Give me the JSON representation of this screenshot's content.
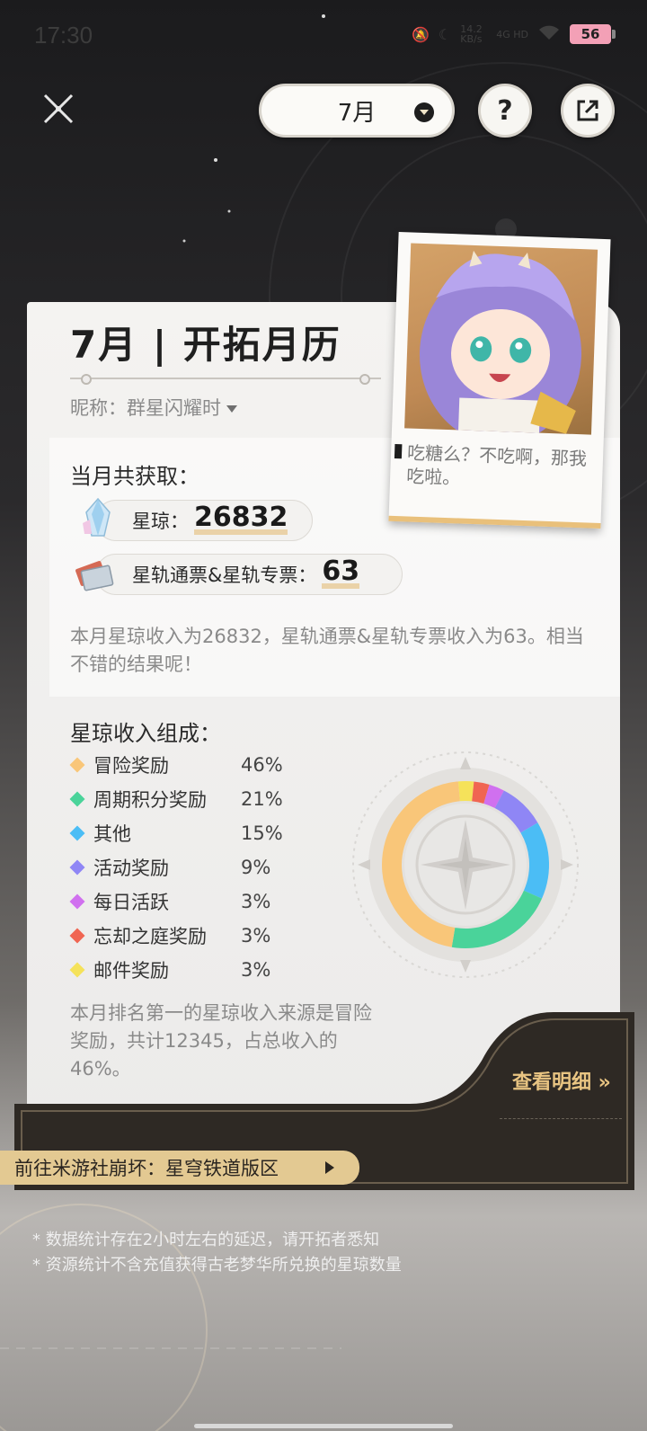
{
  "status_bar": {
    "time": "17:30",
    "network_speed": "14.2 KB/s",
    "network_type": "4G HD",
    "battery": "56"
  },
  "top_bar": {
    "month_selected": "7月",
    "help_label": "?"
  },
  "card": {
    "title": "7月 | 开拓月历",
    "nickname": "昵称：群星闪耀时"
  },
  "summary": {
    "heading": "当月共获取：",
    "stellar_jade_label": "星琼：",
    "stellar_jade_value": "26832",
    "passes_label": "星轨通票&星轨专票：",
    "passes_value": "63",
    "text": "本月星琼收入为26832，星轨通票&星轨专票收入为63。相当不错的结果呢！"
  },
  "character": {
    "quote": "吃糖么？不吃啊，那我吃啦。"
  },
  "composition": {
    "heading": "星琼收入组成：",
    "items": [
      {
        "name": "冒险奖励",
        "percent": "46%",
        "color": "#f9c679"
      },
      {
        "name": "周期积分奖励",
        "percent": "21%",
        "color": "#4ad39a"
      },
      {
        "name": "其他",
        "percent": "15%",
        "color": "#4bbdf5"
      },
      {
        "name": "活动奖励",
        "percent": "9%",
        "color": "#8f86f5"
      },
      {
        "name": "每日活跃",
        "percent": "3%",
        "color": "#d070ef"
      },
      {
        "name": "忘却之庭奖励",
        "percent": "3%",
        "color": "#f06552"
      },
      {
        "name": "邮件奖励",
        "percent": "3%",
        "color": "#f5e25a"
      }
    ],
    "text": "本月排名第一的星琼收入来源是冒险奖励，共计12345，占总收入的46%。"
  },
  "chart_data": {
    "type": "pie",
    "categories": [
      "冒险奖励",
      "周期积分奖励",
      "其他",
      "活动奖励",
      "每日活跃",
      "忘却之庭奖励",
      "邮件奖励"
    ],
    "values": [
      46,
      21,
      15,
      9,
      3,
      3,
      3
    ],
    "title": "",
    "legend": "left"
  },
  "actions": {
    "detail_link": "查看明细 »",
    "forum_button": "前往米游社崩坏：星穹铁道版区"
  },
  "notes": [
    "* 数据统计存在2小时左右的延迟，请开拓者悉知",
    "* 资源统计不含充值获得古老梦华所兑换的星琼数量"
  ]
}
